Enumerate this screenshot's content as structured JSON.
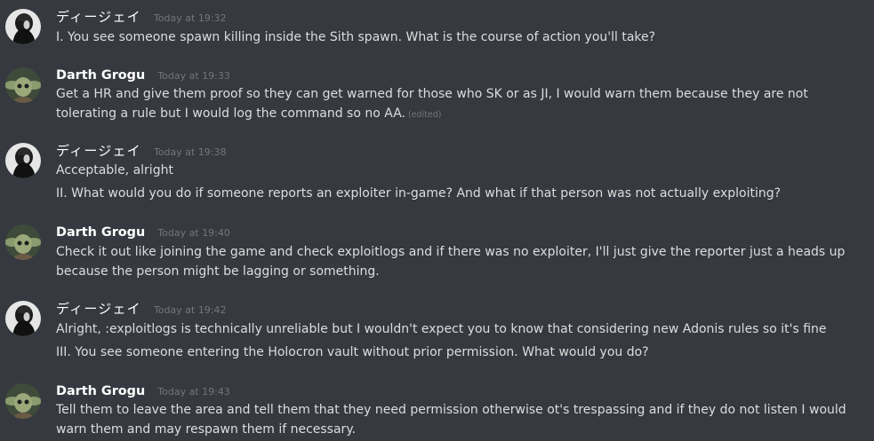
{
  "messages": [
    {
      "username": "ディージェイ",
      "timestamp": "Today at 19:32",
      "avatar": "dj-avatar",
      "lines": [
        "I. You see someone spawn killing inside the Sith spawn. What is the course of action you'll take?"
      ]
    },
    {
      "username": "Darth Grogu",
      "timestamp": "Today at 19:33",
      "avatar": "grogu-avatar",
      "lines": [
        "Get a HR and give them proof so they can get warned for those who SK or as JI, I would warn them because they are not tolerating a rule but I would log the command so no AA."
      ],
      "edited": "(edited)"
    },
    {
      "username": "ディージェイ",
      "timestamp": "Today at 19:38",
      "avatar": "dj-avatar",
      "lines": [
        "Acceptable, alright",
        "II. What would you do if someone reports an exploiter in-game? And what if that person was not actually exploiting?"
      ]
    },
    {
      "username": "Darth Grogu",
      "timestamp": "Today at 19:40",
      "avatar": "grogu-avatar",
      "lines": [
        "Check it out like joining the game and check exploitlogs and if there was no exploiter, I'll just give the reporter just a heads up because the person might be lagging or something."
      ]
    },
    {
      "username": "ディージェイ",
      "timestamp": "Today at 19:42",
      "avatar": "dj-avatar",
      "lines": [
        "Alright, :exploitlogs is technically unreliable but I wouldn't expect you to know that considering new Adonis rules so it's fine",
        "III. You see someone entering the Holocron vault without prior permission. What would you do?"
      ]
    },
    {
      "username": "Darth Grogu",
      "timestamp": "Today at 19:43",
      "avatar": "grogu-avatar",
      "lines": [
        "Tell them to leave the area and tell them that they need permission otherwise ot's trespassing and if they do not listen I would warn them and may respawn them if necessary."
      ]
    }
  ],
  "colors": {
    "background": "#36393f",
    "text": "#dcddde",
    "username": "#ffffff",
    "muted": "#72767d"
  }
}
